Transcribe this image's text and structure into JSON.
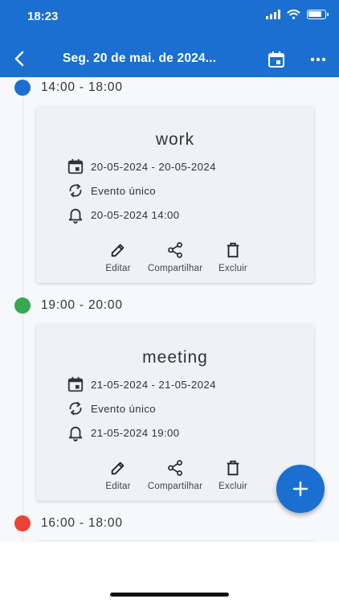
{
  "status_bar": {
    "time": "18:23"
  },
  "toolbar": {
    "title": "Seg. 20 de mai. de 2024...",
    "icons": {
      "back": "back-arrow-icon",
      "calendar": "calendar-icon",
      "more": "more-horizontal-icon"
    }
  },
  "colors": {
    "primary": "#1a6fd1",
    "slot1": "#1a6fd1",
    "slot2": "#34a853",
    "slot3": "#ea4335"
  },
  "events": [
    {
      "time_range": "14:00 - 18:00",
      "title": "work",
      "date_range": "20-05-2024 - 20-05-2024",
      "recurrence": "Evento único",
      "reminder": "20-05-2024 14:00",
      "actions": {
        "edit": "Editar",
        "share": "Compartilhar",
        "delete": "Excluir"
      }
    },
    {
      "time_range": "19:00 - 20:00",
      "title": "meeting",
      "date_range": "21-05-2024 - 21-05-2024",
      "recurrence": "Evento único",
      "reminder": "21-05-2024 19:00",
      "actions": {
        "edit": "Editar",
        "share": "Compartilhar",
        "delete": "Excluir"
      }
    },
    {
      "time_range": "16:00 - 18:00"
    }
  ],
  "fab": {
    "icon": "add-icon"
  }
}
